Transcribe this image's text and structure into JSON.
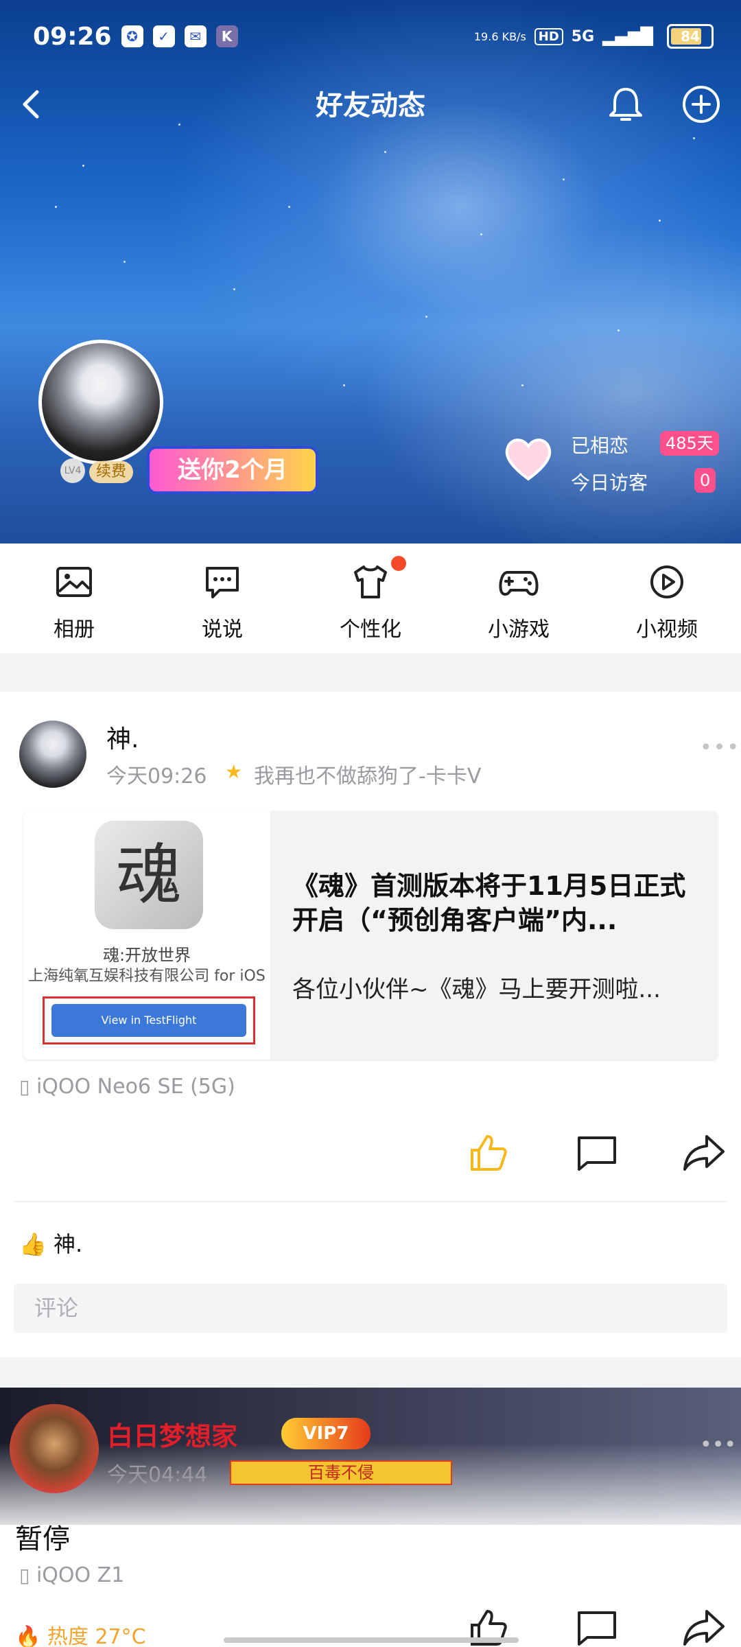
{
  "status_bar": {
    "time": "09:26",
    "net_speed": "19.6 KB/s",
    "hd": "HD",
    "signal": "5G",
    "battery": "84"
  },
  "header": {
    "title": "好友动态"
  },
  "profile": {
    "level": "LV4",
    "renew_label": "续费",
    "gift_label": "送你2个月",
    "in_love_label": "已相恋",
    "in_love_days": "485天",
    "visitors_label": "今日访客",
    "visitors_count": "0"
  },
  "shortcuts": [
    {
      "label": "相册",
      "icon": "photo-album-icon"
    },
    {
      "label": "说说",
      "icon": "chat-bubble-icon"
    },
    {
      "label": "个性化",
      "icon": "tshirt-icon"
    },
    {
      "label": "小游戏",
      "icon": "gamepad-icon"
    },
    {
      "label": "小视频",
      "icon": "play-circle-icon"
    }
  ],
  "post1": {
    "username": "神.",
    "time": "今天09:26",
    "signature": "我再也不做舔狗了-卡卡V",
    "share": {
      "app_icon_char": "魂",
      "app_name": "魂:开放世界",
      "company": "上海纯氧互娱科技有限公司 for iOS",
      "button_label": "View in TestFlight",
      "title": "《魂》首测版本将于11月5日正式开启（“预创角客户端”内...",
      "subtitle": "各位小伙伴~《魂》马上要开测啦..."
    },
    "device": "iQOO Neo6 SE (5G)",
    "likes": "神.",
    "comment_placeholder": "评论"
  },
  "post2": {
    "username": "白日梦想家",
    "vip_label": "VIP7",
    "time": "今天04:44",
    "tag": "百毒不侵",
    "content": "暂停",
    "device": "iQOO Z1",
    "heat": "热度 27°C"
  },
  "colors": {
    "accent_pink": "#ff4f8d",
    "like_yellow": "#f5b91c",
    "name_red": "#e21e2a"
  }
}
